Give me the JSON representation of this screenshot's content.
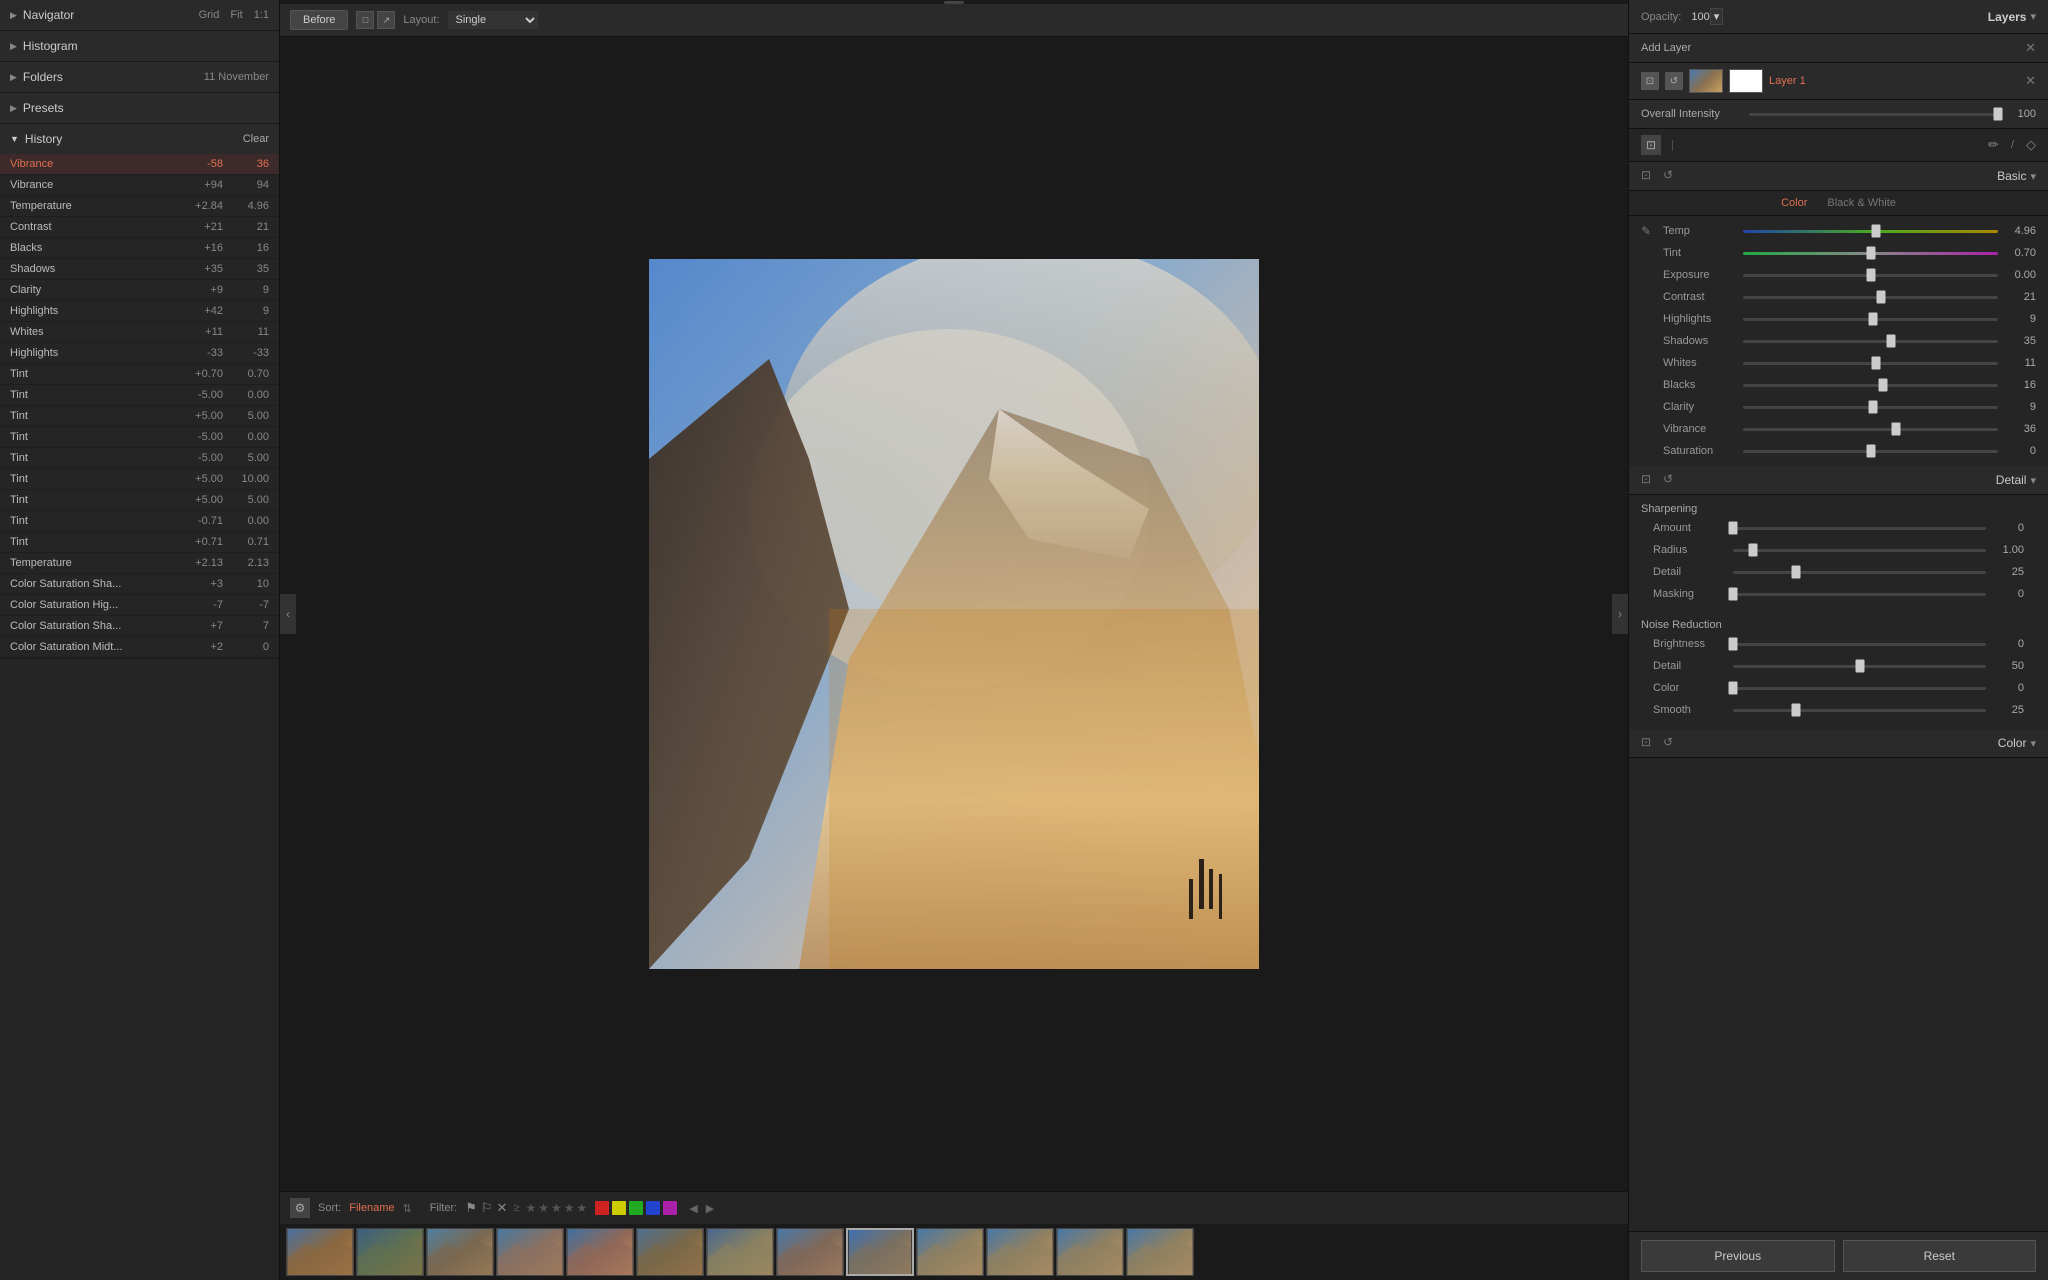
{
  "left": {
    "navigator": {
      "title": "Navigator",
      "grid": "Grid",
      "fit": "Fit",
      "ratio": "1:1"
    },
    "histogram": {
      "title": "Histogram"
    },
    "folders": {
      "title": "Folders",
      "subtitle": "11 November"
    },
    "presets": {
      "title": "Presets"
    },
    "history": {
      "title": "History",
      "clear": "Clear",
      "items": [
        {
          "name": "Vibrance",
          "change": "-58",
          "value": "36",
          "active": true
        },
        {
          "name": "Vibrance",
          "change": "+94",
          "value": "94",
          "active": false
        },
        {
          "name": "Temperature",
          "change": "+2.84",
          "value": "4.96",
          "active": false
        },
        {
          "name": "Contrast",
          "change": "+21",
          "value": "21",
          "active": false
        },
        {
          "name": "Blacks",
          "change": "+16",
          "value": "16",
          "active": false
        },
        {
          "name": "Shadows",
          "change": "+35",
          "value": "35",
          "active": false
        },
        {
          "name": "Clarity",
          "change": "+9",
          "value": "9",
          "active": false
        },
        {
          "name": "Highlights",
          "change": "+42",
          "value": "9",
          "active": false
        },
        {
          "name": "Whites",
          "change": "+11",
          "value": "11",
          "active": false
        },
        {
          "name": "Highlights",
          "change": "-33",
          "value": "-33",
          "active": false
        },
        {
          "name": "Tint",
          "change": "+0.70",
          "value": "0.70",
          "active": false
        },
        {
          "name": "Tint",
          "change": "-5.00",
          "value": "0.00",
          "active": false
        },
        {
          "name": "Tint",
          "change": "+5.00",
          "value": "5.00",
          "active": false
        },
        {
          "name": "Tint",
          "change": "-5.00",
          "value": "0.00",
          "active": false
        },
        {
          "name": "Tint",
          "change": "-5.00",
          "value": "5.00",
          "active": false
        },
        {
          "name": "Tint",
          "change": "+5.00",
          "value": "10.00",
          "active": false
        },
        {
          "name": "Tint",
          "change": "+5.00",
          "value": "5.00",
          "active": false
        },
        {
          "name": "Tint",
          "change": "-0.71",
          "value": "0.00",
          "active": false
        },
        {
          "name": "Tint",
          "change": "+0.71",
          "value": "0.71",
          "active": false
        },
        {
          "name": "Temperature",
          "change": "+2.13",
          "value": "2.13",
          "active": false
        },
        {
          "name": "Color Saturation Sha...",
          "change": "+3",
          "value": "10",
          "active": false
        },
        {
          "name": "Color Saturation Hig...",
          "change": "-7",
          "value": "-7",
          "active": false
        },
        {
          "name": "Color Saturation Sha...",
          "change": "+7",
          "value": "7",
          "active": false
        },
        {
          "name": "Color Saturation Midt...",
          "change": "+2",
          "value": "0",
          "active": false
        }
      ]
    }
  },
  "center": {
    "before_label": "Before",
    "layout_label": "Layout:",
    "layout_value": "Single",
    "sort_label": "Sort:",
    "sort_value": "Filename",
    "filter_label": "Filter:"
  },
  "right": {
    "opacity_label": "Opacity:",
    "opacity_value": "100",
    "layers_title": "Layers",
    "add_layer_label": "Add Layer",
    "layer_name": "Layer 1",
    "overall_intensity_label": "Overall Intensity",
    "overall_intensity_value": "100",
    "basic_title": "Basic",
    "color_tab": "Color",
    "bw_tab": "Black & White",
    "adjustments": [
      {
        "label": "Temp",
        "value": "4.96",
        "type": "temp",
        "pct": 52
      },
      {
        "label": "Tint",
        "value": "0.70",
        "type": "tint",
        "pct": 50
      },
      {
        "label": "Exposure",
        "value": "0.00",
        "type": "normal",
        "pct": 50
      },
      {
        "label": "Contrast",
        "value": "21",
        "type": "normal",
        "pct": 54
      },
      {
        "label": "Highlights",
        "value": "9",
        "type": "normal",
        "pct": 51
      },
      {
        "label": "Shadows",
        "value": "35",
        "type": "normal",
        "pct": 58
      },
      {
        "label": "Whites",
        "value": "11",
        "type": "normal",
        "pct": 52
      },
      {
        "label": "Blacks",
        "value": "16",
        "type": "normal",
        "pct": 55
      },
      {
        "label": "Clarity",
        "value": "9",
        "type": "normal",
        "pct": 51
      },
      {
        "label": "Vibrance",
        "value": "36",
        "type": "normal",
        "pct": 60
      },
      {
        "label": "Saturation",
        "value": "0",
        "type": "normal",
        "pct": 50
      }
    ],
    "detail_title": "Detail",
    "sharpening_label": "Sharpening",
    "sharpening": [
      {
        "label": "Amount",
        "value": "0",
        "pct": 0
      },
      {
        "label": "Radius",
        "value": "1.00",
        "pct": 8
      },
      {
        "label": "Detail",
        "value": "25",
        "pct": 25
      },
      {
        "label": "Masking",
        "value": "0",
        "pct": 0
      }
    ],
    "noise_label": "Noise Reduction",
    "noise": [
      {
        "label": "Brightness",
        "value": "0",
        "pct": 0
      },
      {
        "label": "Detail",
        "value": "50",
        "pct": 50
      },
      {
        "label": "Color",
        "value": "0",
        "pct": 0
      },
      {
        "label": "Smooth",
        "value": "25",
        "pct": 25
      }
    ],
    "color_section_label": "Color",
    "previous_btn": "Previous",
    "reset_btn": "Reset"
  }
}
